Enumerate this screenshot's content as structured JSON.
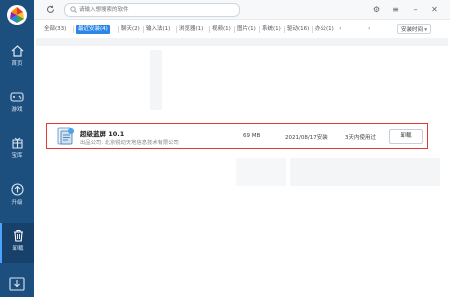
{
  "search": {
    "placeholder": "请输入想搜索的软件"
  },
  "sidebar": {
    "items": [
      {
        "label": "首页",
        "icon": "home-icon"
      },
      {
        "label": "游戏",
        "icon": "gamepad-icon"
      },
      {
        "label": "宝库",
        "icon": "treasure-icon"
      },
      {
        "label": "升级",
        "icon": "upgrade-icon"
      },
      {
        "label": "卸载",
        "icon": "trash-icon",
        "active": true
      }
    ],
    "bottom_icon": "download-icon"
  },
  "tabs": [
    {
      "label": "全部(33)"
    },
    {
      "label": "最近安装(4)",
      "active": true
    },
    {
      "label": "聊天(2)"
    },
    {
      "label": "输入法(1)"
    },
    {
      "label": "浏览器(1)"
    },
    {
      "label": "视频(1)"
    },
    {
      "label": "图片(1)"
    },
    {
      "label": "系统(1)"
    },
    {
      "label": "驱动(16)"
    },
    {
      "label": "办公(1)"
    }
  ],
  "sort": {
    "value": "安装时间"
  },
  "app": {
    "name": "超级蓝屏 10.1",
    "publisher": "出品公司: 北京锐动天地信息技术有限公司",
    "size": "69 MB",
    "install_date": "2021/08/17安装",
    "last_used": "3天内使用过",
    "uninstall_label": "卸载"
  },
  "colors": {
    "sidebar": "#1d4f7e",
    "accent": "#2b86e8",
    "highlight": "#e53935"
  }
}
